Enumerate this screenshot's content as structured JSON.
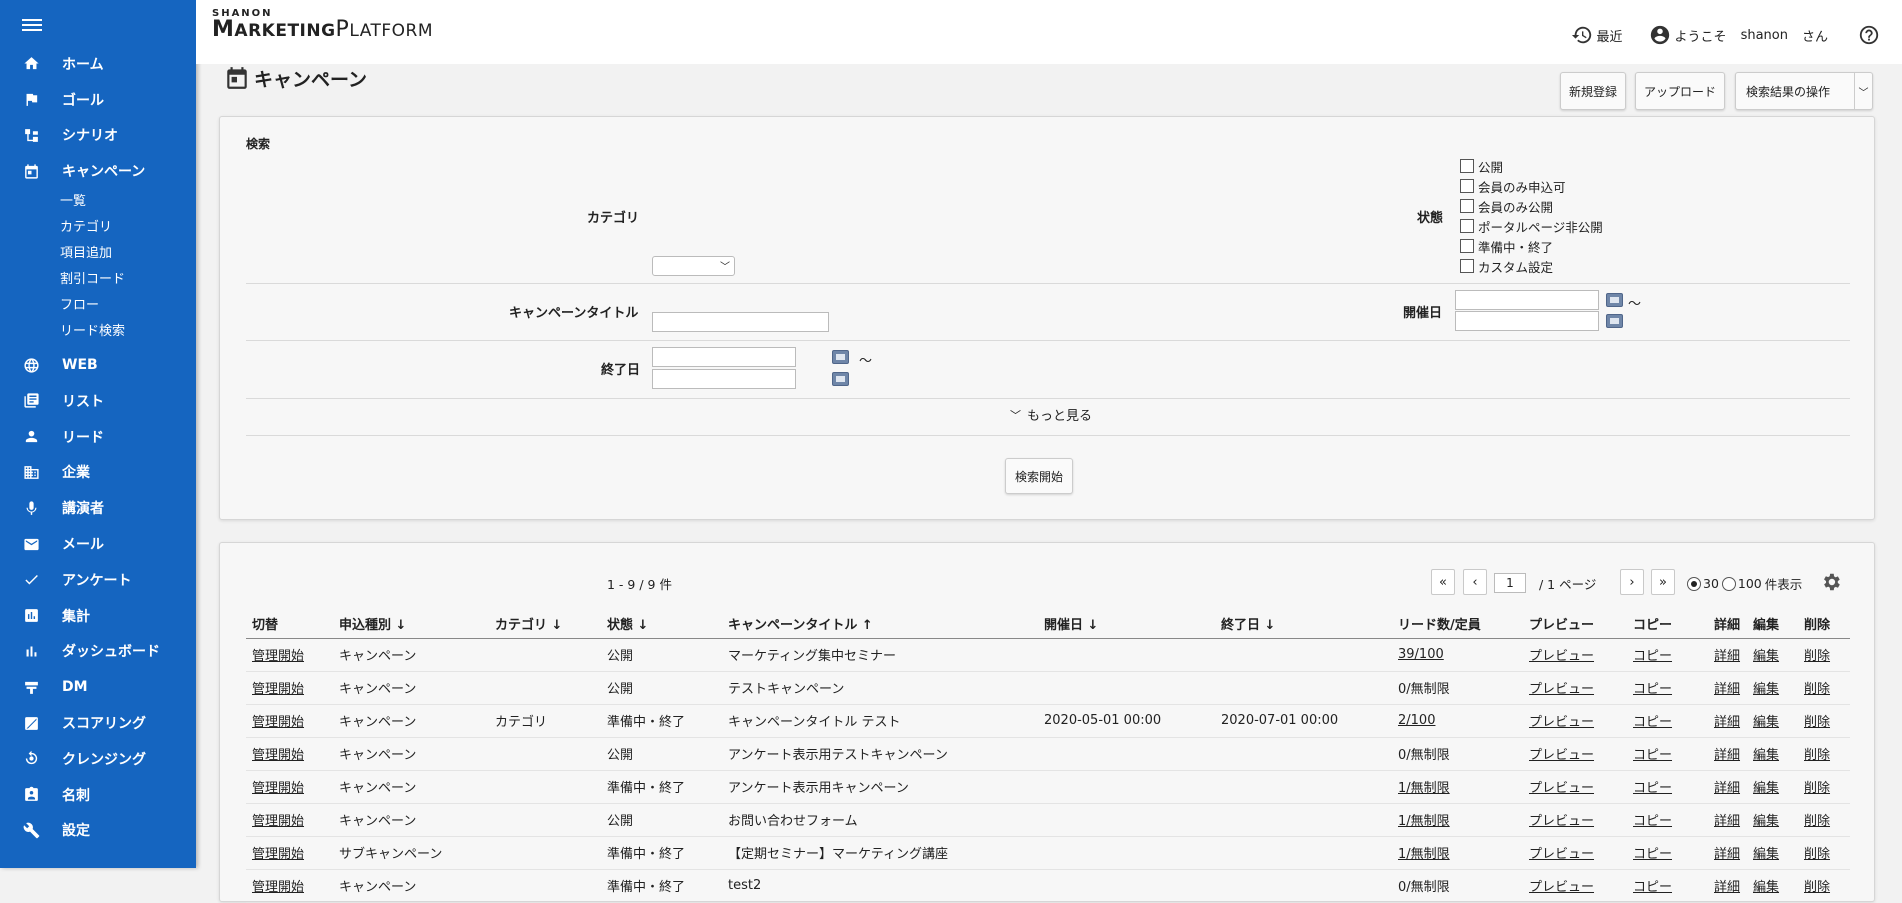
{
  "brand": {
    "small": "SHANON",
    "big_prefix": "M",
    "big_part1": "ARKETING",
    "big_p": "P",
    "big_part2": "LATFORM"
  },
  "header": {
    "recent": "最近",
    "welcome": "ようこそ",
    "user": "shanon",
    "suffix": "さん"
  },
  "sidebar": {
    "items": [
      {
        "label": "ホーム",
        "icon": "home-icon"
      },
      {
        "label": "ゴール",
        "icon": "flag-icon"
      },
      {
        "label": "シナリオ",
        "icon": "scenario-icon"
      },
      {
        "label": "キャンペーン",
        "icon": "calendar-icon"
      },
      {
        "label": "WEB",
        "icon": "globe-icon"
      },
      {
        "label": "リスト",
        "icon": "list-icon"
      },
      {
        "label": "リード",
        "icon": "person-icon"
      },
      {
        "label": "企業",
        "icon": "building-icon"
      },
      {
        "label": "講演者",
        "icon": "mic-icon"
      },
      {
        "label": "メール",
        "icon": "mail-icon"
      },
      {
        "label": "アンケート",
        "icon": "check-icon"
      },
      {
        "label": "集計",
        "icon": "report-icon"
      },
      {
        "label": "ダッシュボード",
        "icon": "bar-chart-icon"
      },
      {
        "label": "DM",
        "icon": "dm-icon"
      },
      {
        "label": "スコアリング",
        "icon": "scoring-icon"
      },
      {
        "label": "クレンジング",
        "icon": "cleansing-icon"
      },
      {
        "label": "名刺",
        "icon": "card-icon"
      },
      {
        "label": "設定",
        "icon": "wrench-icon"
      }
    ],
    "campaign_sub": [
      "一覧",
      "カテゴリ",
      "項目追加",
      "割引コード",
      "フロー",
      "リード検索"
    ]
  },
  "page": {
    "title": "キャンペーン",
    "buttons": {
      "new": "新規登録",
      "upload": "アップロード",
      "ops": "検索結果の操作"
    }
  },
  "search": {
    "heading": "検索",
    "category_label": "カテゴリ",
    "status_label": "状態",
    "status_options": [
      "公開",
      "会員のみ申込可",
      "会員のみ公開",
      "ポータルページ非公開",
      "準備中・終了",
      "カスタム設定"
    ],
    "title_label": "キャンペーンタイトル",
    "start_label": "開催日",
    "end_label": "終了日",
    "tilde": "～",
    "more": "もっと見る",
    "submit": "検索開始"
  },
  "results": {
    "count": "1 - 9 / 9 件",
    "page": "1",
    "page_total": "/ 1 ページ",
    "per_page_30": "30",
    "per_page_100": "100",
    "per_page_suffix": "件表示",
    "columns": [
      "切替",
      "申込種別 ↓",
      "カテゴリ ↓",
      "状態 ↓",
      "キャンペーンタイトル ↑",
      "開催日 ↓",
      "終了日 ↓",
      "リード数/定員",
      "プレビュー",
      "コピー",
      "詳細",
      "編集",
      "削除"
    ],
    "rows": [
      {
        "toggle": "管理開始",
        "type": "キャンペーン",
        "category": "",
        "status": "公開",
        "title": "マーケティング集中セミナー",
        "start": "",
        "end": "",
        "leads": "39/100",
        "leads_link": true
      },
      {
        "toggle": "管理開始",
        "type": "キャンペーン",
        "category": "",
        "status": "公開",
        "title": "テストキャンペーン",
        "start": "",
        "end": "",
        "leads": "0/無制限",
        "leads_link": false
      },
      {
        "toggle": "管理開始",
        "type": "キャンペーン",
        "category": "カテゴリ",
        "status": "準備中・終了",
        "title": "キャンペーンタイトル テスト",
        "start": "2020-05-01 00:00",
        "end": "2020-07-01 00:00",
        "leads": "2/100",
        "leads_link": true
      },
      {
        "toggle": "管理開始",
        "type": "キャンペーン",
        "category": "",
        "status": "公開",
        "title": "アンケート表示用テストキャンペーン",
        "start": "",
        "end": "",
        "leads": "0/無制限",
        "leads_link": false
      },
      {
        "toggle": "管理開始",
        "type": "キャンペーン",
        "category": "",
        "status": "準備中・終了",
        "title": "アンケート表示用キャンペーン",
        "start": "",
        "end": "",
        "leads": "1/無制限",
        "leads_link": true
      },
      {
        "toggle": "管理開始",
        "type": "キャンペーン",
        "category": "",
        "status": "公開",
        "title": "お問い合わせフォーム",
        "start": "",
        "end": "",
        "leads": "1/無制限",
        "leads_link": true
      },
      {
        "toggle": "管理開始",
        "type": "サブキャンペーン",
        "category": "",
        "status": "準備中・終了",
        "title": "【定期セミナー】マーケティング講座",
        "start": "",
        "end": "",
        "leads": "1/無制限",
        "leads_link": true
      },
      {
        "toggle": "管理開始",
        "type": "キャンペーン",
        "category": "",
        "status": "準備中・終了",
        "title": "test2",
        "start": "",
        "end": "",
        "leads": "0/無制限",
        "leads_link": false
      }
    ],
    "actions": {
      "preview": "プレビュー",
      "copy": "コピー",
      "detail": "詳細",
      "edit": "編集",
      "delete": "削除"
    }
  },
  "colors": {
    "sidebar": "#1565c0"
  }
}
